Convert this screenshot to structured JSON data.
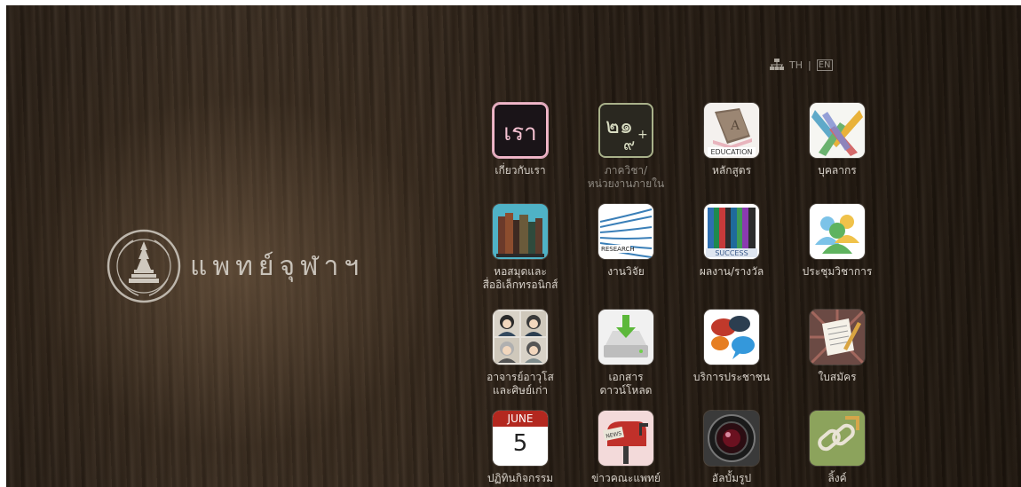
{
  "header": {
    "lang_th": "TH",
    "lang_sep": "|",
    "lang_en": "EN"
  },
  "brand": {
    "name": "แพทย์จุฬาฯ"
  },
  "menu": [
    {
      "label": "เกี่ยวกับเรา",
      "icon": "about-us-icon",
      "glyph": "เรา"
    },
    {
      "label": "ภาควิชา/\nหน่วยงานภายใน",
      "icon": "departments-icon",
      "glyph": "๒๑",
      "glyph2": "๙",
      "glyph3": "+"
    },
    {
      "label": "หลักสูตร",
      "icon": "education-book-icon",
      "caption": "EDUCATION",
      "letter": "A"
    },
    {
      "label": "บุคลากร",
      "icon": "personnel-hands-icon"
    },
    {
      "label": "หอสมุดและ\nสื่ออิเล็กทรอนิกส์",
      "icon": "library-books-icon"
    },
    {
      "label": "งานวิจัย",
      "icon": "research-icon",
      "caption": "RESEARCH"
    },
    {
      "label": "ผลงาน/รางวัล",
      "icon": "success-books-icon",
      "caption": "SUCCESS"
    },
    {
      "label": "ประชุมวิชาการ",
      "icon": "conference-people-icon"
    },
    {
      "label": "อาจารย์อาวุโส\nและศิษย์เก่า",
      "icon": "alumni-faces-icon"
    },
    {
      "label": "เอกสาร\nดาวน์โหลด",
      "icon": "download-drive-icon"
    },
    {
      "label": "บริการประชาชน",
      "icon": "public-service-chat-icon"
    },
    {
      "label": "ใบสมัคร",
      "icon": "application-form-icon"
    },
    {
      "label": "ปฏิทินกิจกรรม",
      "icon": "calendar-icon",
      "month": "JUNE",
      "day": "5"
    },
    {
      "label": "ข่าวคณะแพทย์",
      "icon": "news-mailbox-icon",
      "caption": "NEWS"
    },
    {
      "label": "อัลบั้มรูป",
      "icon": "photo-album-lens-icon"
    },
    {
      "label": "ลิ้งค์",
      "icon": "link-chain-icon"
    }
  ],
  "colors": {
    "label": "#d8d2ca",
    "label_dim": "#8f8a82",
    "brand_text": "#c9c3ba"
  }
}
